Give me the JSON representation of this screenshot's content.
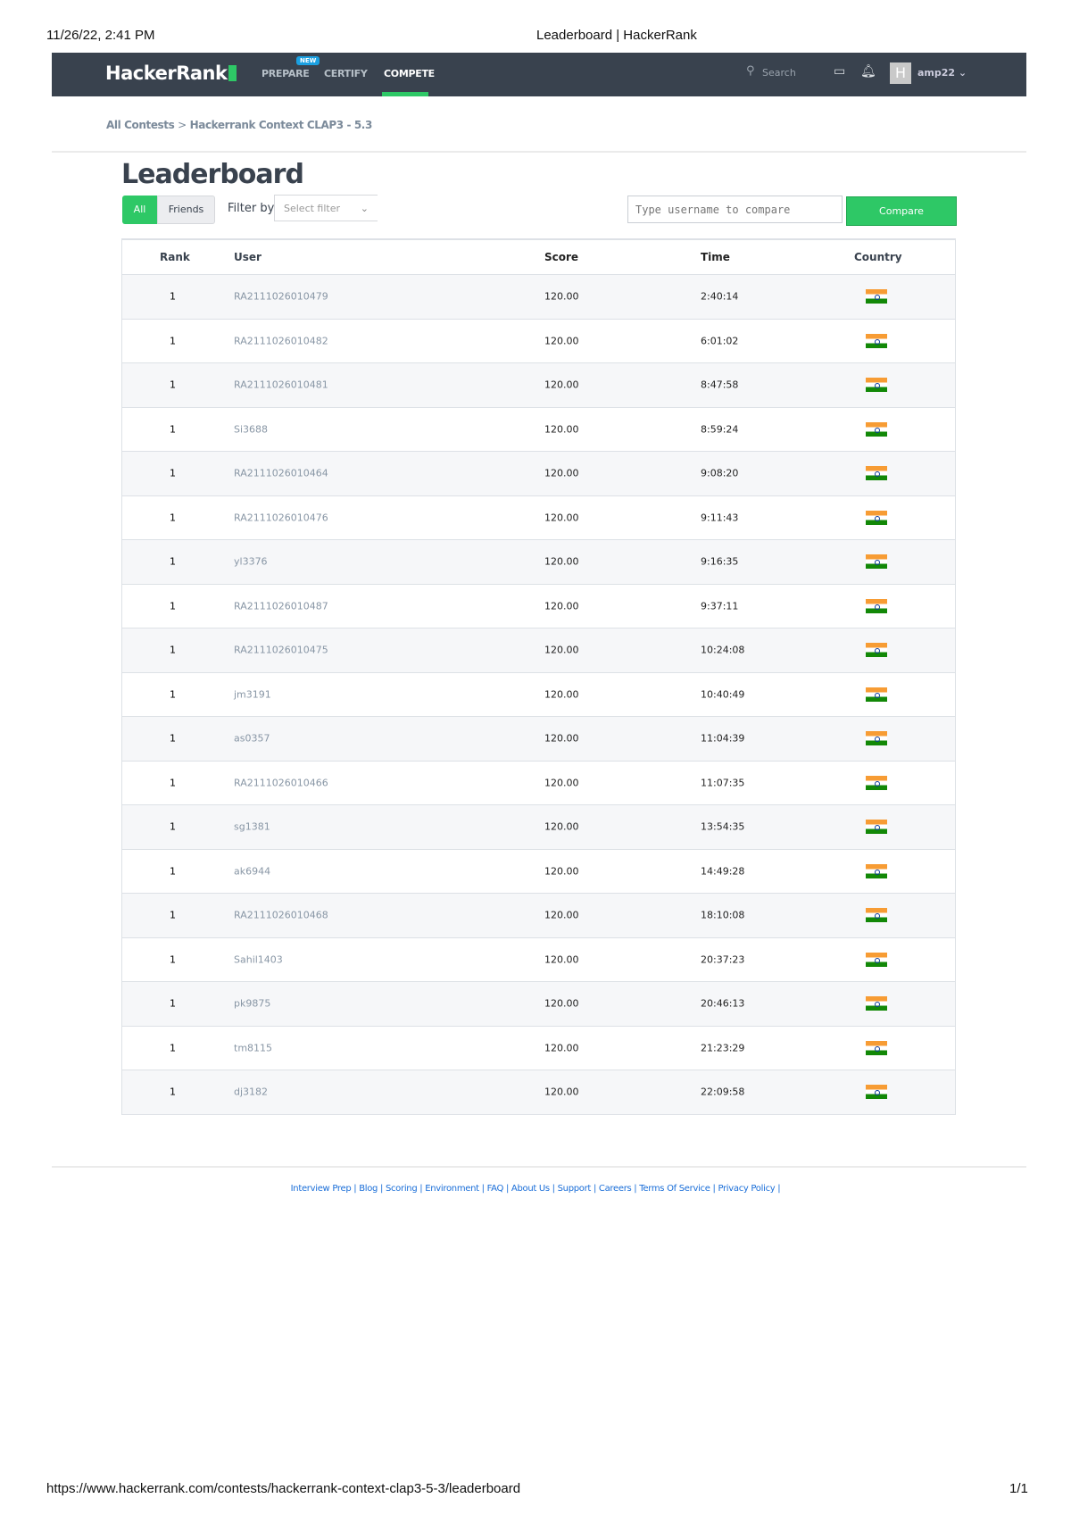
{
  "print_header": {
    "datetime": "11/26/22, 2:41 PM",
    "title": "Leaderboard | HackerRank"
  },
  "print_footer": {
    "url": "https://www.hackerrank.com/contests/hackerrank-context-clap3-5-3/leaderboard",
    "page": "1/1"
  },
  "nav": {
    "logo": "HackerRank",
    "items": [
      "PREPARE",
      "CERTIFY",
      "COMPETE"
    ],
    "badge": "NEW",
    "active": "COMPETE",
    "search_placeholder": "Search",
    "avatar_letter": "H",
    "username": "amp22"
  },
  "breadcrumb": {
    "root": "All Contests",
    "sep": ">",
    "current": "Hackerrank Context CLAP3 - 5.3"
  },
  "page_title": "Leaderboard",
  "filters": {
    "all": "All",
    "friends": "Friends",
    "filter_by": "Filter by",
    "select_placeholder": "Select filter",
    "compare_placeholder": "Type username to compare",
    "compare_button": "Compare"
  },
  "table": {
    "headers": [
      "Rank",
      "User",
      "Score",
      "Time",
      "Country"
    ],
    "rows": [
      {
        "rank": "1",
        "user": "RA2111026010479",
        "score": "120.00",
        "time": "2:40:14",
        "country": "India"
      },
      {
        "rank": "1",
        "user": "RA2111026010482",
        "score": "120.00",
        "time": "6:01:02",
        "country": "India"
      },
      {
        "rank": "1",
        "user": "RA2111026010481",
        "score": "120.00",
        "time": "8:47:58",
        "country": "India"
      },
      {
        "rank": "1",
        "user": "Si3688",
        "score": "120.00",
        "time": "8:59:24",
        "country": "India"
      },
      {
        "rank": "1",
        "user": "RA2111026010464",
        "score": "120.00",
        "time": "9:08:20",
        "country": "India"
      },
      {
        "rank": "1",
        "user": "RA2111026010476",
        "score": "120.00",
        "time": "9:11:43",
        "country": "India"
      },
      {
        "rank": "1",
        "user": "yl3376",
        "score": "120.00",
        "time": "9:16:35",
        "country": "India"
      },
      {
        "rank": "1",
        "user": "RA2111026010487",
        "score": "120.00",
        "time": "9:37:11",
        "country": "India"
      },
      {
        "rank": "1",
        "user": "RA2111026010475",
        "score": "120.00",
        "time": "10:24:08",
        "country": "India"
      },
      {
        "rank": "1",
        "user": "jm3191",
        "score": "120.00",
        "time": "10:40:49",
        "country": "India"
      },
      {
        "rank": "1",
        "user": "as0357",
        "score": "120.00",
        "time": "11:04:39",
        "country": "India"
      },
      {
        "rank": "1",
        "user": "RA2111026010466",
        "score": "120.00",
        "time": "11:07:35",
        "country": "India"
      },
      {
        "rank": "1",
        "user": "sg1381",
        "score": "120.00",
        "time": "13:54:35",
        "country": "India"
      },
      {
        "rank": "1",
        "user": "ak6944",
        "score": "120.00",
        "time": "14:49:28",
        "country": "India"
      },
      {
        "rank": "1",
        "user": "RA2111026010468",
        "score": "120.00",
        "time": "18:10:08",
        "country": "India"
      },
      {
        "rank": "1",
        "user": "Sahil1403",
        "score": "120.00",
        "time": "20:37:23",
        "country": "India"
      },
      {
        "rank": "1",
        "user": "pk9875",
        "score": "120.00",
        "time": "20:46:13",
        "country": "India"
      },
      {
        "rank": "1",
        "user": "tm8115",
        "score": "120.00",
        "time": "21:23:29",
        "country": "India"
      },
      {
        "rank": "1",
        "user": "dj3182",
        "score": "120.00",
        "time": "22:09:58",
        "country": "India"
      }
    ]
  },
  "footer_links": [
    "Interview Prep",
    "Blog",
    "Scoring",
    "Environment",
    "FAQ",
    "About Us",
    "Support",
    "Careers",
    "Terms Of Service",
    "Privacy Policy"
  ]
}
